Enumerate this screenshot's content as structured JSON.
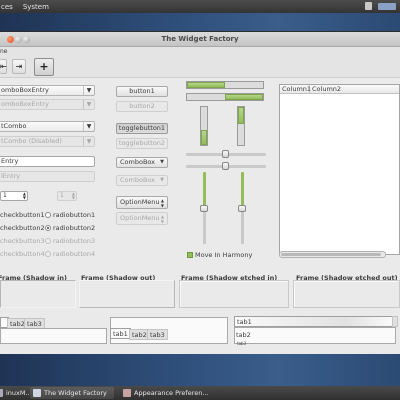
{
  "top_panel": {
    "menus": [
      "ces",
      "System"
    ]
  },
  "window": {
    "title": "The Widget Factory",
    "menu_partial": "ne"
  },
  "toolbar": {
    "btn1_label": "⇤",
    "btn2_label": "⇥",
    "add_label": "+"
  },
  "left_column": {
    "combo_entry": "omboBoxEntry",
    "combo_entry_disabled": "omboBoxEntry",
    "combo": "tCombo",
    "combo_disabled": "tCombo (Disabled)",
    "entry": "Entry",
    "entry_disabled": "lEntry",
    "spin_value": "1",
    "spin_disabled_value": "1",
    "checkbuttons": [
      "checkbutton1",
      "checkbutton2",
      "checkbutton3",
      "checkbutton4"
    ],
    "radiobuttons": [
      "radiobutton1",
      "radiobutton2",
      "radiobutton3",
      "radiobutton4"
    ]
  },
  "middle_column": {
    "button1": "button1",
    "button2": "button2",
    "togglebutton1": "togglebutton1",
    "togglebutton2": "togglebutton2",
    "combobox": "ComboBox",
    "combobox_disabled": "ComboBox",
    "optionmenu": "OptionMenu",
    "optionmenu_disabled": "OptionMenu"
  },
  "harmony": {
    "label": "Move In Harmony",
    "checked": true
  },
  "progress": {
    "h1": 0.5,
    "h2": 0.5,
    "v1": 0.4,
    "v2": 0.45
  },
  "tree": {
    "columns": [
      "Column1",
      "Column2"
    ]
  },
  "frames": [
    "Frame (Shadow in)",
    "Frame (Shadow out)",
    "Frame (Shadow etched in)",
    "Frame (Shadow etched out)"
  ],
  "notebooks": {
    "nb1_tabs": [
      "tab1",
      "tab2",
      "tab3"
    ],
    "nb2_tabs": [
      "tab1",
      "tab2",
      "tab3"
    ],
    "nb3_tabs": [
      "tab1",
      "tab2"
    ],
    "nb3_small": "tab3"
  },
  "taskbar": {
    "items": [
      "inuxM...",
      "The Widget Factory",
      "Appearance Preferen..."
    ]
  },
  "colors": {
    "accent_green": "#92bd5a",
    "close_orange": "#e0502b",
    "panel_dark": "#3c3c3c"
  }
}
